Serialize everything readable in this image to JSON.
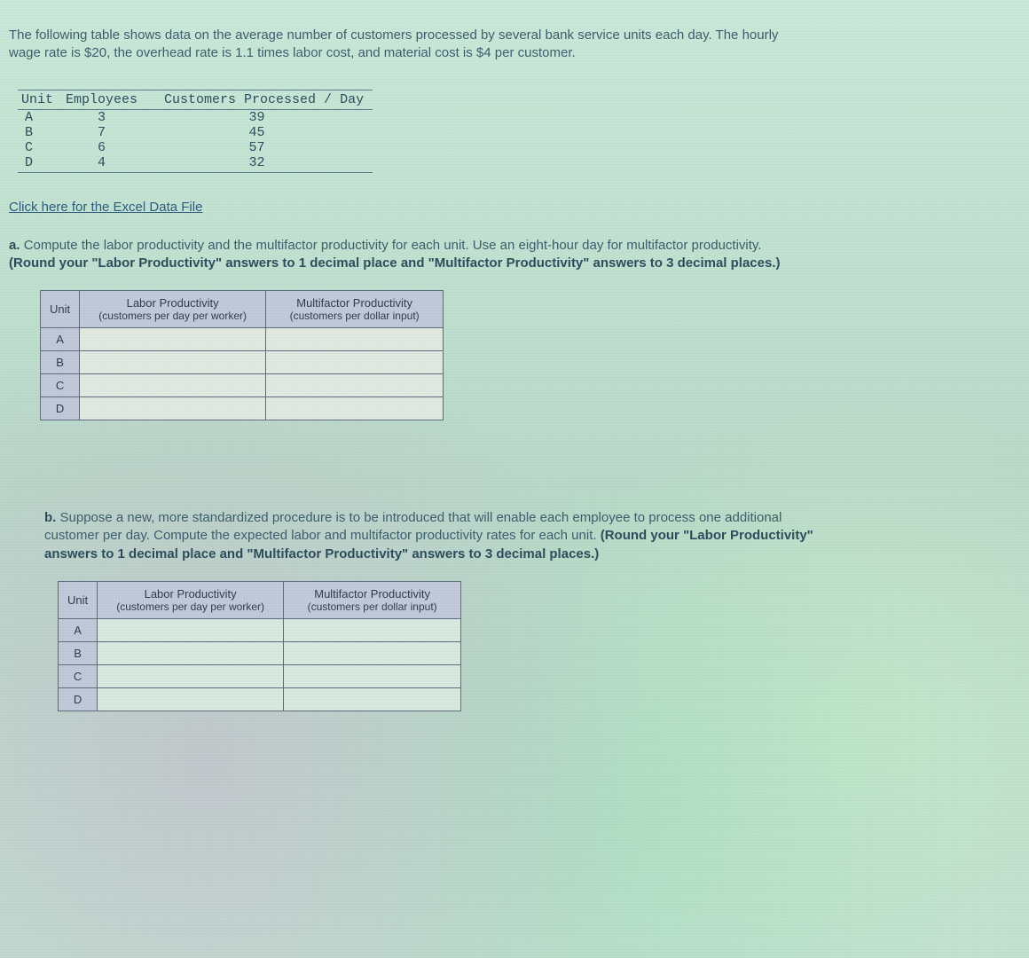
{
  "intro": {
    "line1": "The following table shows data on the average number of customers processed by several bank service units each day. The hourly",
    "line2": "wage rate is $20, the overhead rate is 1.1 times labor cost, and material cost is $4 per customer."
  },
  "data_table": {
    "headers": {
      "unit": "Unit",
      "employees": "Employees",
      "customers": "Customers Processed / Day"
    },
    "rows": [
      {
        "unit": "A",
        "employees": "3",
        "customers": "39"
      },
      {
        "unit": "B",
        "employees": "7",
        "customers": "45"
      },
      {
        "unit": "C",
        "employees": "6",
        "customers": "57"
      },
      {
        "unit": "D",
        "employees": "4",
        "customers": "32"
      }
    ]
  },
  "excel_link": "Click here for the Excel Data File",
  "part_a": {
    "lead": "a. ",
    "text": "Compute the labor productivity and the multifactor productivity for each unit. Use an eight-hour day for multifactor productivity.",
    "bold": "(Round your \"Labor Productivity\" answers to 1 decimal place and \"Multifactor Productivity\" answers to 3 decimal places.)"
  },
  "answer_headers": {
    "unit": "Unit",
    "labor": "Labor Productivity",
    "labor_sub": "(customers per day per worker)",
    "multi": "Multifactor Productivity",
    "multi_sub": "(customers per dollar input)"
  },
  "units": [
    "A",
    "B",
    "C",
    "D"
  ],
  "part_b": {
    "lead": "b. ",
    "text1": "Suppose a new, more standardized procedure is to be introduced that will enable each employee to process one additional",
    "text2": "customer per day. Compute the expected labor and multifactor productivity rates for each unit. ",
    "bold1": "(Round your \"Labor Productivity\"",
    "bold2": "answers to 1 decimal place and \"Multifactor Productivity\" answers to 3 decimal places.)"
  },
  "chart_data": {
    "type": "table",
    "title": "Bank service units — customers processed per day",
    "columns": [
      "Unit",
      "Employees",
      "Customers Processed / Day"
    ],
    "rows": [
      [
        "A",
        3,
        39
      ],
      [
        "B",
        7,
        45
      ],
      [
        "C",
        6,
        57
      ],
      [
        "D",
        4,
        32
      ]
    ],
    "parameters": {
      "hourly_wage_rate_usd": 20,
      "overhead_rate_times_labor_cost": 1.1,
      "material_cost_per_customer_usd": 4,
      "hours_per_day_for_multifactor": 8
    }
  }
}
